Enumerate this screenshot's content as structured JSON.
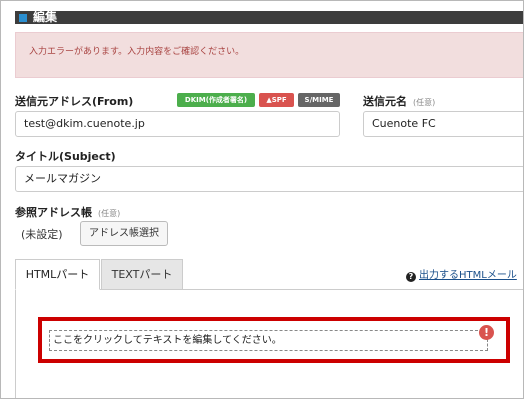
{
  "section": {
    "title": "編集"
  },
  "error": {
    "message": "入力エラーがあります。入力内容をご確認ください。"
  },
  "from": {
    "label": "送信元アドレス(From)",
    "value": "test@dkim.cuenote.jp",
    "badges": {
      "dkim": "DKIM(作成者署名)",
      "spf": "▲SPF",
      "smime": "S/MIME"
    }
  },
  "sender_name": {
    "label": "送信元名",
    "optional": "(任意)",
    "value": "Cuenote FC"
  },
  "subject": {
    "label": "タイトル(Subject)",
    "value": "メールマガジン"
  },
  "address_book": {
    "label": "参照アドレス帳",
    "optional": "(任意)",
    "status": "(未設定)",
    "select_button": "アドレス帳選択"
  },
  "tabs": [
    {
      "label": "HTMLパート",
      "active": true
    },
    {
      "label": "TEXTパート",
      "active": false
    }
  ],
  "help_link": {
    "icon": "?",
    "text": "出力するHTMLメール"
  },
  "editor": {
    "placeholder": "ここをクリックしてテキストを編集してください。",
    "error_icon": "!"
  },
  "colors": {
    "error_border": "#cc0000",
    "dkim": "#4cae4c",
    "spf": "#d9534f",
    "smime": "#666666",
    "accent": "#2b8fd0"
  }
}
